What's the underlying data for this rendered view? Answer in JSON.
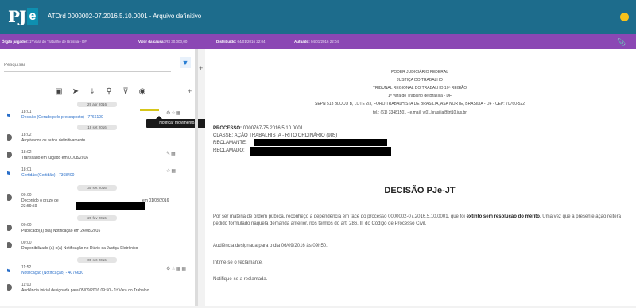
{
  "header": {
    "logo_pj": "PJ",
    "logo_e": "e",
    "title": "ATOrd 0000002-07.2016.5.10.0001 - Arquivo definitivo"
  },
  "infobar": {
    "orgao_label": "Órgão julgador:",
    "orgao_value": "1ª Vara do Trabalho de Brasília - DF",
    "valor_label": "Valor da causa:",
    "valor_value": "R$ 30.000,00",
    "distribuicao_label": "Distribuído:",
    "distribuicao_value": "04/01/2016 22:04",
    "autuacao_label": "Autuado:",
    "autuacao_value": "04/01/2016 22:04"
  },
  "left": {
    "search_placeholder": "Pesquisar",
    "toolbar_icons": [
      "pdf-icon",
      "push-pin-icon",
      "download-icon",
      "search-icon",
      "filter-icon",
      "eye-icon"
    ],
    "dates": [
      "29 abr 2016",
      "19 set 2016",
      "30 set 2016",
      "29 fev 2016",
      "20 fev 2016",
      "09 set 2016"
    ],
    "events": [
      {
        "time": "18:01",
        "desc": "Decisão (Gerado pelo pressuposto) - 7766100"
      },
      {
        "time": "18:02",
        "desc": "Arquivados os autos definitivamente"
      },
      {
        "time": "18:02",
        "desc": "Transitado em julgado em 01/08/2016"
      },
      {
        "time": "18:01",
        "desc": "Certidão (Certidão) - 7368400"
      },
      {
        "time": "00:00",
        "desc": "Decorrido o prazo de",
        "desc2": "em 01/08/2016",
        "sub": "23:59:59"
      },
      {
        "time": "00:00",
        "desc": "Publicado(a) o(a) Notificação em 24/08/2016"
      },
      {
        "time": "00:00",
        "desc": "Disponibilizado (a) o(a) Notificação no Diário da Justiça Eletrônico"
      },
      {
        "time": "11:52",
        "desc": "Notificação (Notificação) - 4076630"
      },
      {
        "time": "11:00",
        "desc": "Audiência inicial designada para 05/09/2016 09:50 - 1ª Vara do Trabalho"
      }
    ],
    "tooltip": "Notificar movimento."
  },
  "document": {
    "header_lines": [
      "PODER JUDICIÁRIO FEDERAL",
      "JUSTIÇA DO TRABALHO",
      "TRIBUNAL REGIONAL DO TRABALHO 10ª REGIÃO",
      "1ª Vara do Trabalho de Brasília - DF",
      "SEPN 513 BLOCO B, LOTE 2/3, FORO TRABALHISTA DE BRASÍLIA, ASA NORTE, BRASILIA - DF - CEP: 70760-522",
      "tel.: (61) 33481501 - e.mail: vt01.brasilia@trt10.jus.br"
    ],
    "processo_label": "PROCESSO:",
    "processo_value": "0000767-75.2016.5.10.0001",
    "classe": "CLASSE: AÇÃO TRABALHISTA - RITO ORDINÁRIO (985)",
    "reclamante_label": "RECLAMANTE:",
    "reclamado_label": "RECLAMADO:",
    "title": "DECISÃO PJe-JT",
    "para1_pre": "Por ser matéria de ordem pública, reconheço a dependência em face do processo 0000002-07.2016.5.10.0001, que foi",
    "para1_bold": "extinto sem resolução do mérito",
    "para1_post": ". Uma vez que a presente ação reitera pedido formulado naquela demanda anterior, nos termos do art. 286, II, do Código de Processo Civil.",
    "para2": "Audiência designada para o dia 06/09/2016 às 09h50.",
    "para3": "Intime-se o reclamante.",
    "para4": "Notifique-se a reclamada."
  }
}
